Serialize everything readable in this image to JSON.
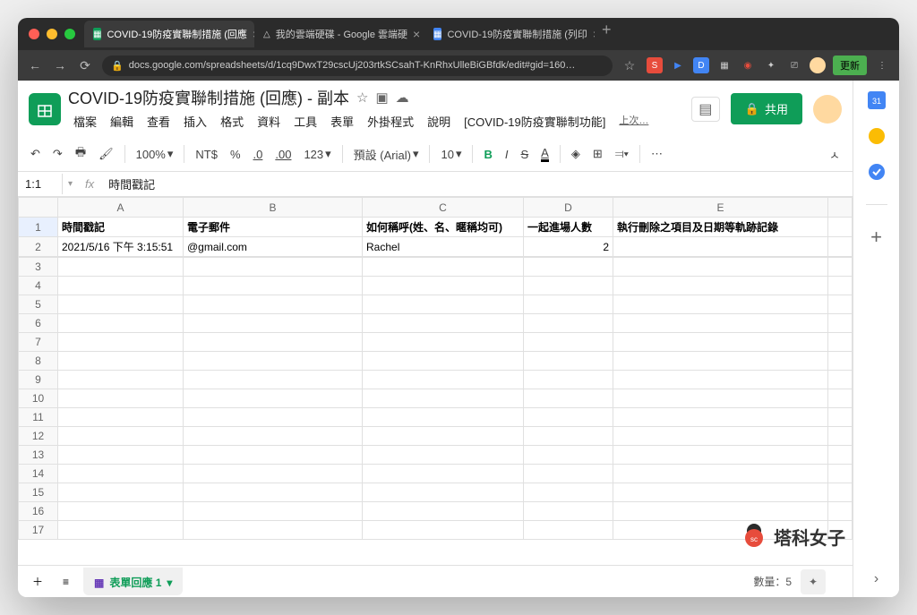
{
  "browser": {
    "tabs": [
      {
        "title": "COVID-19防疫實聯制措施 (回應",
        "icon": "S",
        "icon_bg": "#0f9d58",
        "active": true
      },
      {
        "title": "我的雲端硬碟 - Google 雲端硬",
        "icon": "△",
        "icon_bg": "#4285f4",
        "active": false
      },
      {
        "title": "COVID-19防疫實聯制措施 (列印",
        "icon": "D",
        "icon_bg": "#4285f4",
        "active": false
      }
    ],
    "url": "docs.google.com/spreadsheets/d/1cq9DwxT29cscUj203rtkSCsahT-KnRhxUlleBiGBfdk/edit#gid=160…",
    "update_label": "更新"
  },
  "doc": {
    "title": "COVID-19防疫實聯制措施 (回應) - 副本",
    "menus": [
      "檔案",
      "編輯",
      "查看",
      "插入",
      "格式",
      "資料",
      "工具",
      "表單",
      "外掛程式",
      "說明",
      "[COVID-19防疫實聯制功能]"
    ],
    "last_save": "上次…",
    "share_label": "共用"
  },
  "toolbar": {
    "zoom": "100%",
    "currency": "NT$",
    "percent": "%",
    "dec_dec": ".0",
    "dec_inc": ".00",
    "num_format": "123",
    "font": "預設 (Arial)",
    "font_size": "10",
    "bold": "B",
    "italic": "I",
    "strike": "S",
    "underline": "A"
  },
  "namebox": "1:1",
  "formula": "時間戳記",
  "sheet": {
    "columns": [
      "A",
      "B",
      "C",
      "D",
      "E"
    ],
    "headers": [
      "時間戳記",
      "電子郵件",
      "如何稱呼(姓、名、暱稱均可)",
      "一起進場人數",
      "執行刪除之項目及日期等軌跡記錄"
    ],
    "rows": [
      {
        "n": 1,
        "cells": [
          "時間戳記",
          "電子郵件",
          "如何稱呼(姓、名、暱稱均可)",
          "一起進場人數",
          "執行刪除之項目及日期等軌跡記錄"
        ],
        "header": true
      },
      {
        "n": 2,
        "cells": [
          "2021/5/16 下午 3:15:51",
          "           @gmail.com",
          "Rachel",
          "2",
          ""
        ],
        "header": false
      }
    ],
    "empty_rows": [
      3,
      4,
      5,
      6,
      7,
      8,
      9,
      10,
      11,
      12,
      13,
      14,
      15,
      16,
      17
    ]
  },
  "bottom": {
    "sheet_name": "表單回應 1",
    "count_label": "數量：5"
  },
  "watermark": "塔科女子"
}
